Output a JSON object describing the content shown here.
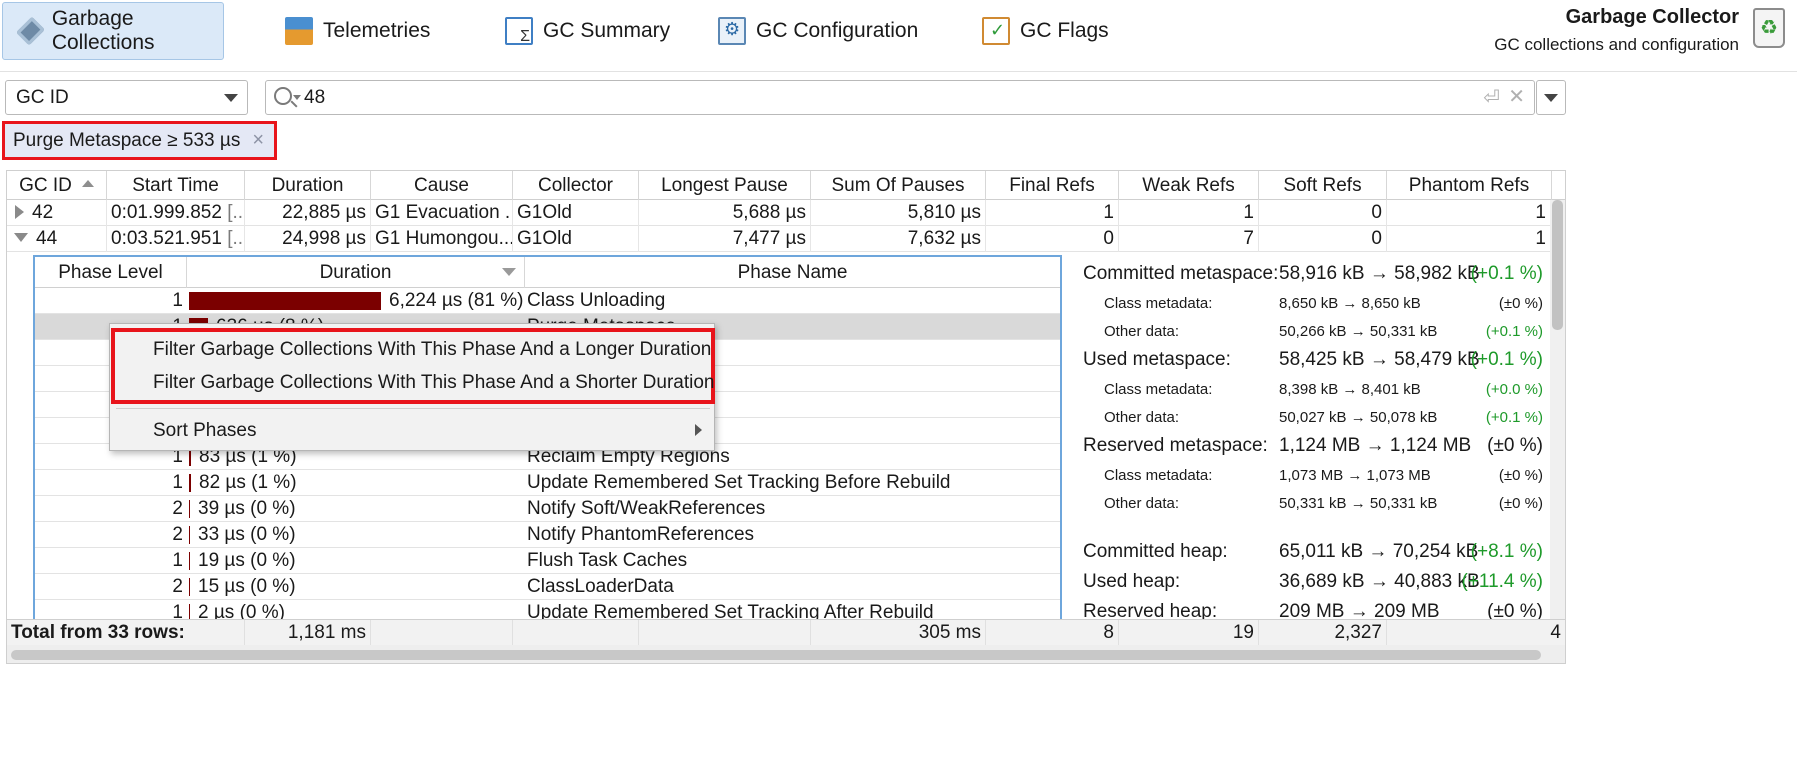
{
  "toolbar": {
    "tabs": [
      {
        "label": "Garbage Collections",
        "icon": "gc-icon",
        "active": true
      },
      {
        "label": "Telemetries",
        "icon": "telemetry-icon"
      },
      {
        "label": "GC Summary",
        "icon": "summary-icon"
      },
      {
        "label": "GC Configuration",
        "icon": "configuration-icon"
      },
      {
        "label": "GC Flags",
        "icon": "flags-icon"
      }
    ],
    "title": "Garbage Collector",
    "subtitle": "GC collections and configuration",
    "title_icon": "recycle-bin-icon"
  },
  "filter": {
    "column_select": "GC ID",
    "search_value": "48",
    "chip_label": "Purge Metaspace ≥ 533 µs",
    "chip_close": "×"
  },
  "table": {
    "headers": [
      "GC ID",
      "Start Time",
      "Duration",
      "Cause",
      "Collector",
      "Longest Pause",
      "Sum Of Pauses",
      "Final Refs",
      "Weak Refs",
      "Soft Refs",
      "Phantom Refs"
    ],
    "rows": [
      {
        "gc_id": "42",
        "start_time": "0:01.999.852",
        "start_more": "[...",
        "duration": "22,885 µs",
        "cause": "G1 Evacuation ...",
        "collector": "G1Old",
        "longest_pause": "5,688 µs",
        "sum_pauses": "5,810 µs",
        "final_refs": "1",
        "weak_refs": "1",
        "soft_refs": "0",
        "phantom_refs": "1"
      },
      {
        "gc_id": "44",
        "start_time": "0:03.521.951",
        "start_more": "[...",
        "duration": "24,998 µs",
        "cause": "G1 Humongou...",
        "collector": "G1Old",
        "longest_pause": "7,477 µs",
        "sum_pauses": "7,632 µs",
        "final_refs": "0",
        "weak_refs": "7",
        "soft_refs": "0",
        "phantom_refs": "1"
      }
    ],
    "total": {
      "label": "Total from 33 rows:",
      "duration": "1,181 ms",
      "sum_pauses": "305 ms",
      "final_refs": "8",
      "weak_refs": "19",
      "soft_refs": "2,327",
      "phantom_refs": "4"
    }
  },
  "phases": {
    "headers": [
      "Phase Level",
      "Duration",
      "Phase Name"
    ],
    "rows": [
      {
        "level": "1",
        "duration": "6,224 µs (81 %)",
        "pct": 81,
        "name": "Class Unloading"
      },
      {
        "level": "1",
        "duration": "636 µs (8 %)",
        "pct": 8,
        "name": "Purge Metaspace",
        "selected": true
      },
      {
        "level": "",
        "duration": "",
        "pct": 0,
        "name": ""
      },
      {
        "level": "",
        "duration": "",
        "pct": 0,
        "name": "rk Cleanup"
      },
      {
        "level": "",
        "duration": "",
        "pct": 0,
        "name": ""
      },
      {
        "level": "",
        "duration": "",
        "pct": 0,
        "name": ""
      },
      {
        "level": "1",
        "duration": "83 µs (1 %)",
        "pct": 1,
        "name": "Reclaim Empty Regions"
      },
      {
        "level": "1",
        "duration": "82 µs (1 %)",
        "pct": 1,
        "name": "Update Remembered Set Tracking Before Rebuild"
      },
      {
        "level": "2",
        "duration": "39 µs (0 %)",
        "pct": 0,
        "name": "Notify Soft/WeakReferences"
      },
      {
        "level": "2",
        "duration": "33 µs (0 %)",
        "pct": 0,
        "name": "Notify PhantomReferences"
      },
      {
        "level": "1",
        "duration": "19 µs (0 %)",
        "pct": 0,
        "name": "Flush Task Caches"
      },
      {
        "level": "2",
        "duration": "15 µs (0 %)",
        "pct": 0,
        "name": "ClassLoaderData"
      },
      {
        "level": "1",
        "duration": "2 µs (0 %)",
        "pct": 0,
        "name": "Update Remembered Set Tracking After Rebuild"
      }
    ]
  },
  "metaspace": {
    "committed": {
      "label": "Committed metaspace:",
      "value": "58,916 kB → 58,982 kB",
      "pct": "(+0.1 %)"
    },
    "committed_class": {
      "label": "Class metadata:",
      "value": "8,650 kB → 8,650 kB",
      "pct": "(±0 %)"
    },
    "committed_other": {
      "label": "Other data:",
      "value": "50,266 kB → 50,331 kB",
      "pct": "(+0.1 %)"
    },
    "used": {
      "label": "Used metaspace:",
      "value": "58,425 kB → 58,479 kB",
      "pct": "(+0.1 %)"
    },
    "used_class": {
      "label": "Class metadata:",
      "value": "8,398 kB → 8,401 kB",
      "pct": "(+0.0 %)"
    },
    "used_other": {
      "label": "Other data:",
      "value": "50,027 kB → 50,078 kB",
      "pct": "(+0.1 %)"
    },
    "reserved": {
      "label": "Reserved metaspace:",
      "value": "1,124 MB → 1,124 MB",
      "pct": "(±0 %)"
    },
    "reserved_class": {
      "label": "Class metadata:",
      "value": "1,073 MB → 1,073 MB",
      "pct": "(±0 %)"
    },
    "reserved_other": {
      "label": "Other data:",
      "value": "50,331 kB → 50,331 kB",
      "pct": "(±0 %)"
    },
    "committed_heap": {
      "label": "Committed heap:",
      "value": "65,011 kB → 70,254 kB",
      "pct": "(+8.1 %)"
    },
    "used_heap": {
      "label": "Used heap:",
      "value": "36,689 kB → 40,883 kB",
      "pct": "(+11.4 %)"
    },
    "reserved_heap": {
      "label": "Reserved heap:",
      "value": "209 MB → 209 MB",
      "pct": "(±0 %)"
    }
  },
  "context_menu": {
    "items": [
      "Filter Garbage Collections With This Phase And a Longer Duration",
      "Filter Garbage Collections With This Phase And a Shorter Duration",
      "Sort Phases"
    ]
  },
  "colors": {
    "accent_red": "#e8141b",
    "bar": "#7b0000",
    "positive": "#1e9a2a",
    "active_tab": "#dbe9f8"
  }
}
